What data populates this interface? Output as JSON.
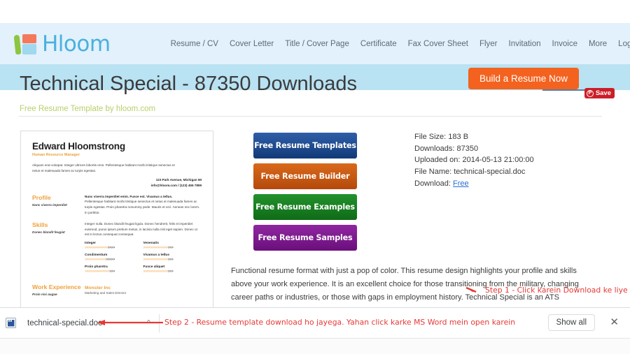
{
  "brand": {
    "logo_text": "Hloom",
    "logo_icon": "hloom-logo-icon"
  },
  "nav": {
    "items": [
      {
        "label": "Resume / CV"
      },
      {
        "label": "Cover Letter"
      },
      {
        "label": "Title / Cover Page"
      },
      {
        "label": "Certificate"
      },
      {
        "label": "Fax Cover Sheet"
      },
      {
        "label": "Flyer"
      },
      {
        "label": "Invitation"
      },
      {
        "label": "Invoice"
      },
      {
        "label": "More"
      },
      {
        "label": "Login | Sign Up"
      }
    ],
    "search_icon": "search-icon"
  },
  "cta": {
    "build_label": "Build a Resume Now",
    "color": "#f4621f"
  },
  "page": {
    "title": "Technical Special - 87350 Downloads",
    "subtitle": "Free Resume Template by hloom.com"
  },
  "pinterest": {
    "label": "Save",
    "glyph": "P",
    "color": "#cb1f27"
  },
  "resume_preview": {
    "name": "Edward Hloomstrong",
    "role": "Human Resource Manager",
    "intro": "Aliquam erat volutpat. Integer ultrices lobortis eros. Pellentesque habitant morbi tristique senectus et netus et malesuada fames ac turpis egestas.",
    "contact_line1": "123 Park Avenue, Michigan MI",
    "contact_line2": "info@hloom.com / (123) 456 7899",
    "profile_heading": "Profile",
    "profile_sub": "Nunc viverra imperdiet",
    "profile_lead": "Nunc viverra imperdiet enim. Fusce est. Vivamus a tellus.",
    "profile_body": "Pellentesque habitant morbi tristique senectus et netus et malesuada fames ac turpis egestas. Proin pharetra nonummy pede. Mauris et orci. Aenean nec lorem. In porttitor.",
    "skills_heading": "Skills",
    "skills_sub": "Donec blandit feugiat",
    "skills_body": "Integer nulla. Donec blandit feugiat ligula. Donec hendrerit, felis et imperdiet euismod, purus ipsum pretium metus, in lacinia nulla nisl eget sapien. Donec ut est in lectus consequat consequat.",
    "skills": [
      {
        "name": "Integer",
        "rating": 4
      },
      {
        "name": "Venenatis",
        "rating": 3
      },
      {
        "name": "Condimentum",
        "rating": 5
      },
      {
        "name": "Vivamus a tellus",
        "rating": 3
      },
      {
        "name": "Proin pharetra",
        "rating": 3
      },
      {
        "name": "Fusce aliquet",
        "rating": 3
      }
    ],
    "work_heading": "Work Experience",
    "work_sub": "Proin nisi augue",
    "company": "Monster Inc",
    "job_line": "Marketing and Sales Director"
  },
  "buttons": [
    {
      "label": "Free Resume Templates",
      "color": "#2f5fa8",
      "name": "free-resume-templates-button"
    },
    {
      "label": "Free Resume Builder",
      "color": "#d9691a",
      "name": "free-resume-builder-button"
    },
    {
      "label": "Free Resume Examples",
      "color": "#23922c",
      "name": "free-resume-examples-button"
    },
    {
      "label": "Free Resume Samples",
      "color": "#8f27a0",
      "name": "free-resume-samples-button"
    }
  ],
  "file_meta": {
    "file_size_label": "File Size: 183 B",
    "downloads_label": "Downloads: 87350",
    "uploaded_label": "Uploaded on: 2014-05-13 21:00:00",
    "file_name_label": "File Name: technical-special.doc",
    "download_prefix": "Download: ",
    "download_link": "Free"
  },
  "annotations": {
    "step1": "Step 1 - Click karein Download ke liye",
    "step2": "Step 2 - Resume template download ho jayega. Yahan click karke MS Word mein open karein",
    "color": "#e53935"
  },
  "description": "Functional resume format with just a pop of color. This resume design highlights your profile and skills above your work experience. It is an excellent choice for those transitioning from the military, changing career paths or industries, or those with gaps in employment history. Technical Special is an ATS optimized resume designed to make it past the resume scanning robots.",
  "download_shelf": {
    "file_name": "technical-special.doc",
    "file_icon": "word-doc-icon",
    "caret": "⌃",
    "show_all_label": "Show all",
    "close_label": "✕"
  }
}
